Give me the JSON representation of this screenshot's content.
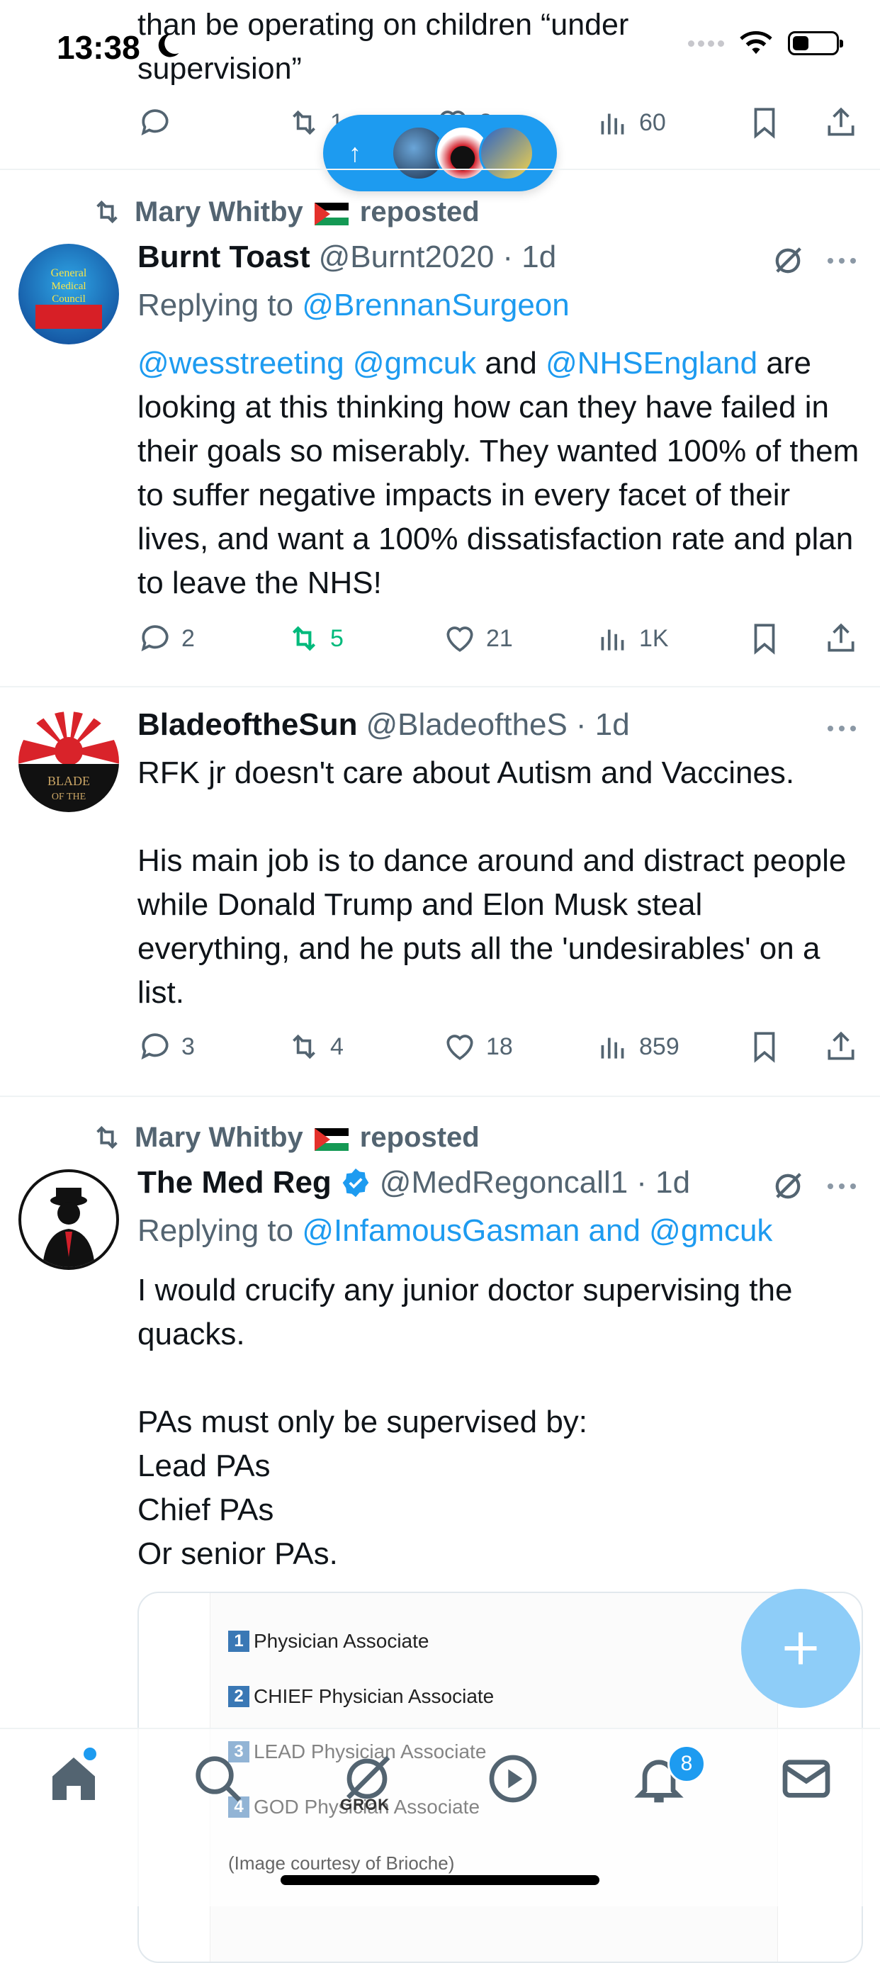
{
  "status": {
    "time": "13:38"
  },
  "top_post": {
    "text_tail": "than be operating on children “under supervision”",
    "views": "60",
    "retweets_partial": "1",
    "likes_partial": "3"
  },
  "new_posts_pill": {
    "arrow": "↑"
  },
  "posts": [
    {
      "repost_by": "Mary Whitby",
      "repost_label": "reposted",
      "name": "Burnt Toast",
      "handle": "@Burnt2020",
      "time": "· 1d",
      "reply_prefix": "Replying to",
      "reply_to": "@BrennanSurgeon",
      "mentions": [
        "@wesstreeting",
        "@gmcuk"
      ],
      "body_and": "and",
      "mention3": "@NHSEngland",
      "body_rest": " are looking at this thinking how can they have failed in their goals so miserably. They wanted 100% of them to suffer negative impacts in every facet of their lives, and want a 100% dissatisfaction rate and plan to leave the NHS!",
      "replies": "2",
      "retweets": "5",
      "likes": "21",
      "views": "1K"
    },
    {
      "name": "BladeoftheSun",
      "handle": "@BladeoftheS",
      "time": "· 1d",
      "body": "RFK jr doesn't care about Autism and Vaccines.\n\nHis main job is to dance around and distract people while Donald Trump and Elon Musk steal everything, and he puts all the 'undesirables' on a list.",
      "replies": "3",
      "retweets": "4",
      "likes": "18",
      "views": "859"
    },
    {
      "repost_by": "Mary Whitby",
      "repost_label": "reposted",
      "name": "The Med Reg",
      "handle": "@MedRegoncall1",
      "time": "· 1d",
      "reply_prefix": "Replying to",
      "reply_to": "@InfamousGasman and @gmcuk",
      "body": "I would crucify any junior doctor supervising the quacks.\n\nPAs must only be supervised by:\nLead PAs\nChief PAs\nOr senior PAs.",
      "card": {
        "items": [
          {
            "n": "1",
            "label": "Physician Associate"
          },
          {
            "n": "2",
            "label": "CHIEF Physician Associate"
          },
          {
            "n": "3",
            "label": "LEAD Physician Associate"
          },
          {
            "n": "4",
            "label": "GOD Physician Associate"
          }
        ],
        "caption": "(Image courtesy of Brioche)"
      }
    }
  ],
  "tabbar": {
    "grok_label": "GROK",
    "notifications_badge": "8"
  },
  "colors": {
    "accent": "#1d9bf0",
    "retweet_green": "#00ba7c",
    "muted": "#536471"
  }
}
